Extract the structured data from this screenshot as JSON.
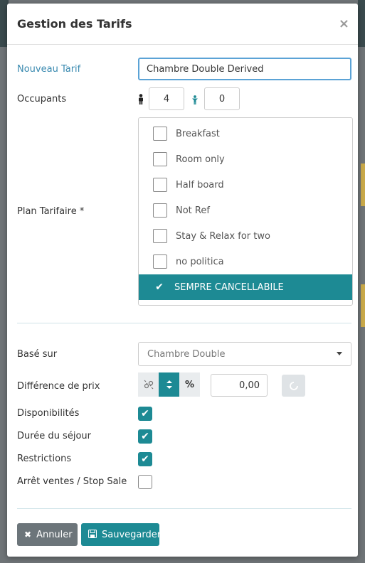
{
  "modal": {
    "title": "Gestion des Tarifs",
    "close_icon": "×"
  },
  "nouveau_tarif": {
    "label": "Nouveau Tarif",
    "value": "Chambre Double Derived"
  },
  "occupants": {
    "label": "Occupants",
    "adults": "4",
    "children": "0"
  },
  "plan_tarifaire": {
    "label": "Plan Tarifaire  *",
    "items": [
      {
        "label": "Breakfast",
        "selected": false
      },
      {
        "label": "Room only",
        "selected": false
      },
      {
        "label": "Half board",
        "selected": false
      },
      {
        "label": "Not Ref",
        "selected": false
      },
      {
        "label": "Stay & Relax for two",
        "selected": false
      },
      {
        "label": "no politica",
        "selected": false
      },
      {
        "label": "SEMPRE CANCELLABILE",
        "selected": true
      }
    ]
  },
  "base_sur": {
    "label": "Basé sur",
    "value": "Chambre Double"
  },
  "difference_prix": {
    "label": "Différence de prix",
    "percent_symbol": "%",
    "value": "0,00"
  },
  "options": [
    {
      "label": "Disponibilités",
      "checked": true
    },
    {
      "label": "Durée du séjour",
      "checked": true
    },
    {
      "label": "Restrictions",
      "checked": true
    },
    {
      "label": "Arrêt ventes / Stop Sale",
      "checked": false
    }
  ],
  "buttons": {
    "cancel": "Annuler",
    "save": "Sauvegarder"
  },
  "colors": {
    "accent": "#1d8a94",
    "label_blue": "#3a8ab0",
    "cancel_gray": "#6c757a"
  }
}
